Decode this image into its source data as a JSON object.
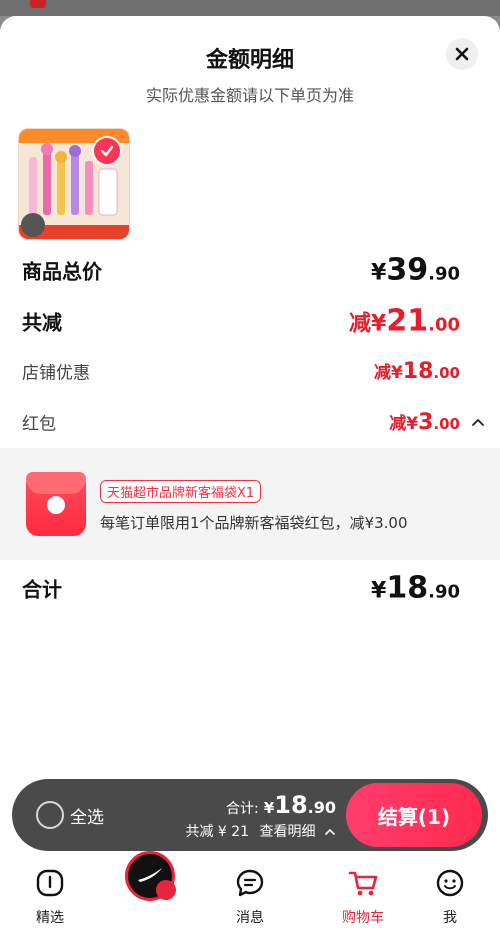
{
  "sheet": {
    "title": "金额明细",
    "subtitle": "实际优惠金额请以下单页为准"
  },
  "rows": {
    "total_price": {
      "label": "商品总价",
      "prefix": "¥",
      "int": "39",
      "dec": ".90"
    },
    "total_reduce": {
      "label": "共减",
      "prefix": "减¥",
      "int": "21",
      "dec": ".00"
    },
    "store_discount": {
      "label": "店铺优惠",
      "prefix": "减¥",
      "int": "18",
      "dec": ".00"
    },
    "red_packet": {
      "label": "红包",
      "prefix": "减¥",
      "int": "3",
      "dec": ".00"
    },
    "sum": {
      "label": "合计",
      "prefix": "¥",
      "int": "18",
      "dec": ".90"
    }
  },
  "coupon": {
    "tag": "天猫超市品牌新客福袋X1",
    "description": "每笔订单限用1个品牌新客福袋红包，减¥3.00"
  },
  "bottom_bar": {
    "select_all": "全选",
    "sum_key": "合计:",
    "sum_prefix": "¥",
    "sum_int": "18",
    "sum_dec": ".90",
    "reduce_text": "共减 ¥ 21",
    "detail_link": "查看明细",
    "checkout": "结算(1)"
  },
  "tabbar": {
    "items": [
      {
        "label": "精选",
        "icon": "home-icon"
      },
      {
        "label": "",
        "icon": "live-icon"
      },
      {
        "label": "消息",
        "icon": "message-icon"
      },
      {
        "label": "购物车",
        "icon": "cart-icon"
      },
      {
        "label": "我",
        "icon": "profile-icon"
      }
    ]
  },
  "colors": {
    "accent_red": "#e61e2c",
    "checkout_gradient_start": "#ff3d6d",
    "checkout_gradient_end": "#ff2a4e"
  }
}
